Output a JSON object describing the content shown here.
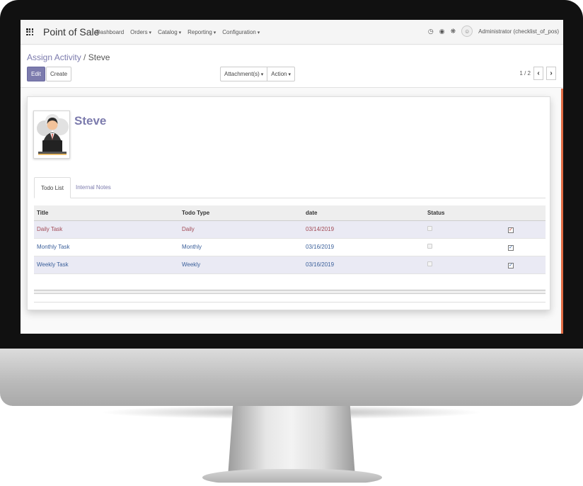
{
  "topbar": {
    "app_title": "Point of Sale",
    "menu": [
      "Dashboard",
      "Orders",
      "Catalog",
      "Reporting",
      "Configuration"
    ],
    "user": "Administrator (checklist_of_pos)"
  },
  "breadcrumb": {
    "parent": "Assign Activity",
    "separator": "/",
    "current": "Steve"
  },
  "toolbar": {
    "edit_label": "Edit",
    "create_label": "Create",
    "attachments_label": "Attachment(s)",
    "action_label": "Action"
  },
  "pager": {
    "value": "1 / 2",
    "prev": "‹",
    "next": "›"
  },
  "record": {
    "name": "Steve"
  },
  "tabs": [
    "Todo List",
    "Internal Notes"
  ],
  "table": {
    "headers": [
      "Title",
      "Todo Type",
      "date",
      "Status",
      ""
    ],
    "rows": [
      {
        "title": "Daily Task",
        "type": "Daily",
        "date": "03/14/2019",
        "status_checked": false,
        "color": "#a24a55"
      },
      {
        "title": "Monthly Task",
        "type": "Monthly",
        "date": "03/16/2019",
        "status_checked": false,
        "color": "#3a5f9a"
      },
      {
        "title": "Weekly Task",
        "type": "Weekly",
        "date": "03/16/2019",
        "status_checked": false,
        "color": "#3a5f9a"
      }
    ]
  },
  "colors": {
    "accent": "#7c7bad",
    "scroll_accent": "#e36e46"
  }
}
